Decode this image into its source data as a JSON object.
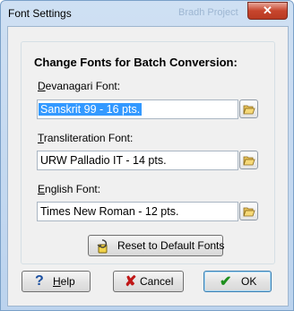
{
  "window": {
    "title": "Font Settings",
    "background_title": "Bradh Project",
    "close_glyph": "✕"
  },
  "group": {
    "title": "Change Fonts for Batch Conversion:"
  },
  "devanagari": {
    "label_u": "D",
    "label_rest": "evanagari Font:",
    "value": "Sanskrit 99 - 16 pts."
  },
  "translit": {
    "label_u": "T",
    "label_rest": "ransliteration Font:",
    "value": "URW Palladio IT - 14 pts."
  },
  "english": {
    "label_u": "E",
    "label_rest": "nglish Font:",
    "value": "Times New Roman - 12 pts."
  },
  "reset": {
    "label": "Reset to Default Fonts"
  },
  "buttons": {
    "help_u": "H",
    "help_rest": "elp",
    "cancel": "Cancel",
    "ok": "OK"
  },
  "colors": {
    "selection": "#3399ff",
    "accent": "#3c7fb1"
  }
}
